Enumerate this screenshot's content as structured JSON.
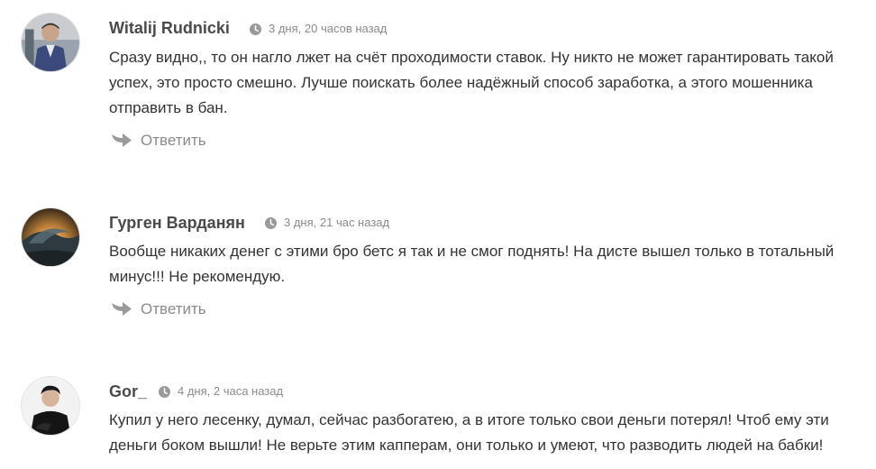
{
  "comments": [
    {
      "author": "Witalij Rudnicki",
      "time": "3 дня, 20 часов назад",
      "text": "Сразу видно,, то он нагло лжет на счёт проходимости ставок. Ну никто не может гарантировать такой успех, это просто смешно. Лучше поискать более надёжный способ заработка, а этого мошенника отправить в бан.",
      "reply_label": "Ответить",
      "avatar_icon": "avatar-icon"
    },
    {
      "author": "Гурген Варданян",
      "time": "3 дня, 21 час назад",
      "text": "Вообще никаких денег с этими бро бетс я так и не смог поднять! На дисте вышел только в тотальный минус!!! Не рекомендую.",
      "reply_label": "Ответить",
      "avatar_icon": "avatar-icon"
    },
    {
      "author": "Gor_",
      "time": "4 дня, 2 часа назад",
      "text": "Купил у него лесенку, думал, сейчас разбогатею, а в итоге только свои деньги потерял! Чтоб ему эти деньги боком вышли! Не верьте этим капперам, они только и умеют, что разводить людей на бабки!",
      "avatar_icon": "avatar-icon"
    }
  ],
  "colors": {
    "author": "#4a4a4a",
    "meta": "#8a8a8a",
    "text": "#333333"
  }
}
